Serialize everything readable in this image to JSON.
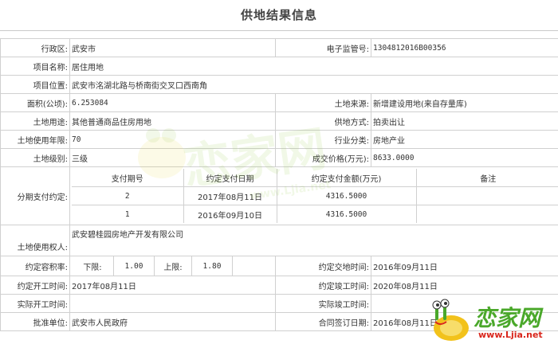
{
  "page": {
    "title": "供地结果信息"
  },
  "fields": {
    "district_label": "行政区:",
    "district": "武安市",
    "supervision_no_label": "电子监管号:",
    "supervision_no": "1304812016B00356",
    "project_name_label": "项目名称:",
    "project_name": "居住用地",
    "project_location_label": "项目位置:",
    "project_location": "武安市洺湖北路与桥南街交叉口西南角",
    "area_label": "面积(公顷):",
    "area": "6.253084",
    "land_source_label": "土地来源:",
    "land_source": "新增建设用地(来自存量库)",
    "land_use_label": "土地用途:",
    "land_use": "其他普通商品住房用地",
    "supply_method_label": "供地方式:",
    "supply_method": "拍卖出让",
    "use_years_label": "土地使用年限:",
    "use_years": "70",
    "industry_label": "行业分类:",
    "industry": "房地产业",
    "land_grade_label": "土地级别:",
    "land_grade": "三级",
    "deal_price_label": "成交价格(万元):",
    "deal_price": "8633.0000",
    "installment_label": "分期支付约定:",
    "land_user_label": "土地使用权人:",
    "land_user": "武安碧桂园房地产开发有限公司",
    "plot_ratio_label": "约定容积率:",
    "lower_label": "下限:",
    "lower": "1.00",
    "upper_label": "上限:",
    "upper": "1.80",
    "handover_label": "约定交地时间:",
    "handover": "2016年09月11日",
    "start_label": "约定开工时间:",
    "start": "2017年08月11日",
    "complete_label": "约定竣工时间:",
    "complete": "2020年08月11日",
    "actual_start_label": "实际开工时间:",
    "actual_start": "",
    "actual_complete_label": "实际竣工时间:",
    "actual_complete": "",
    "approver_label": "批准单位:",
    "approver": "武安市人民政府",
    "contract_date_label": "合同签订日期:",
    "contract_date": "2016年08月11日"
  },
  "installments": {
    "headers": [
      "支付期号",
      "约定支付日期",
      "约定支付金额(万元)",
      "备注"
    ],
    "rows": [
      [
        "2",
        "2017年08月11日",
        "4316.5000",
        ""
      ],
      [
        "1",
        "2016年09月10日",
        "4316.5000",
        ""
      ]
    ]
  },
  "watermark": {
    "text": "恋家网",
    "url": "www.Ljia.net"
  },
  "logo": {
    "text": "恋家网",
    "url": "www.Ljia.net"
  },
  "colors": {
    "border": "#d0d0d0",
    "logo_green": "#4aa82a",
    "logo_red": "#d9261c"
  }
}
